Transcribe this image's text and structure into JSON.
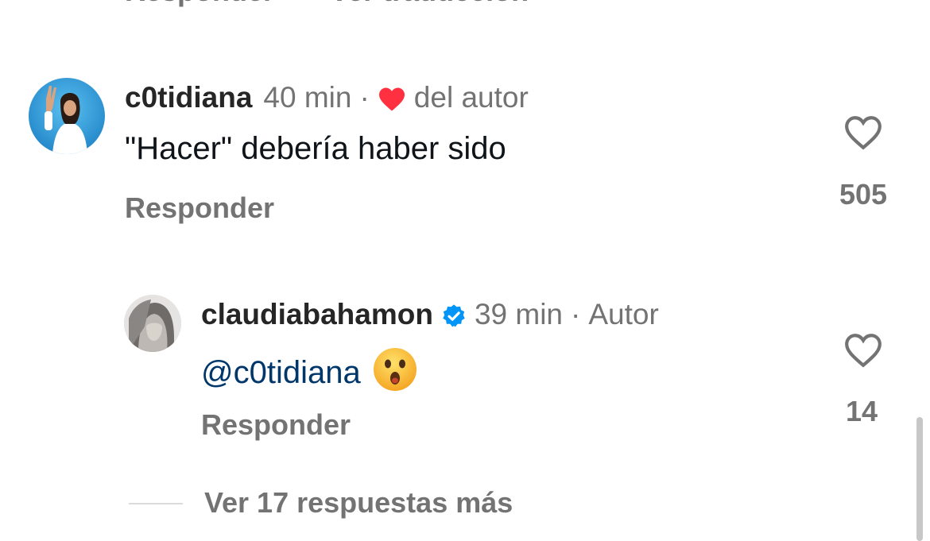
{
  "previous_comment": {
    "reply_label": "Responder",
    "translate_label": "Ver traducción"
  },
  "comment": {
    "username": "c0tidiana",
    "time": "40 min",
    "separator": "·",
    "author_like_label": "del autor",
    "text": "\"Hacer\" debería haber sido",
    "reply_label": "Responder",
    "likes": "505"
  },
  "reply": {
    "username": "claudiabahamon",
    "time": "39 min",
    "separator": "·",
    "author_badge": "Autor",
    "mention": "@c0tidiana",
    "emoji": "😮",
    "reply_label": "Responder",
    "likes": "14"
  },
  "view_more_label": "Ver 17 respuestas más",
  "icons": {
    "heart_red": "heart-filled-icon",
    "verified": "verified-badge-icon",
    "like": "heart-outline-icon"
  },
  "colors": {
    "heart_red": "#ff3040",
    "verified_blue": "#0095f6",
    "mention_blue": "#00376b",
    "secondary_text": "#737373"
  }
}
